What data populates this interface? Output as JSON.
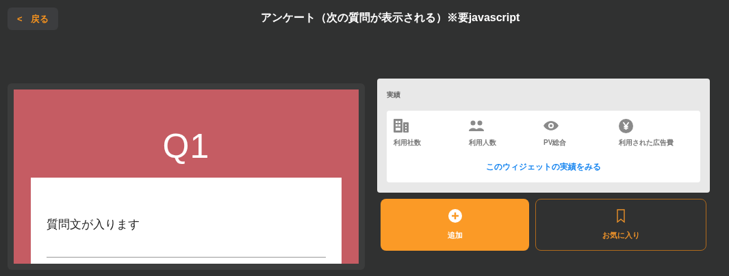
{
  "header": {
    "back_label": "戻る",
    "back_arrow": "<",
    "title": "アンケート（次の質問が表示される）※要javascript"
  },
  "preview": {
    "question_number": "Q1",
    "question_text": "質問文が入ります"
  },
  "stats": {
    "title": "実績",
    "items": [
      {
        "kind": "building",
        "label": "利用社数"
      },
      {
        "kind": "people",
        "label": "利用人数"
      },
      {
        "kind": "eye",
        "label": "PV総合"
      },
      {
        "kind": "yen",
        "label": "利用された広告費"
      }
    ],
    "link": "このウィジェットの実績をみる"
  },
  "actions": [
    {
      "kind": "add",
      "label": "追加"
    },
    {
      "kind": "favorite",
      "label": "お気に入り"
    }
  ]
}
